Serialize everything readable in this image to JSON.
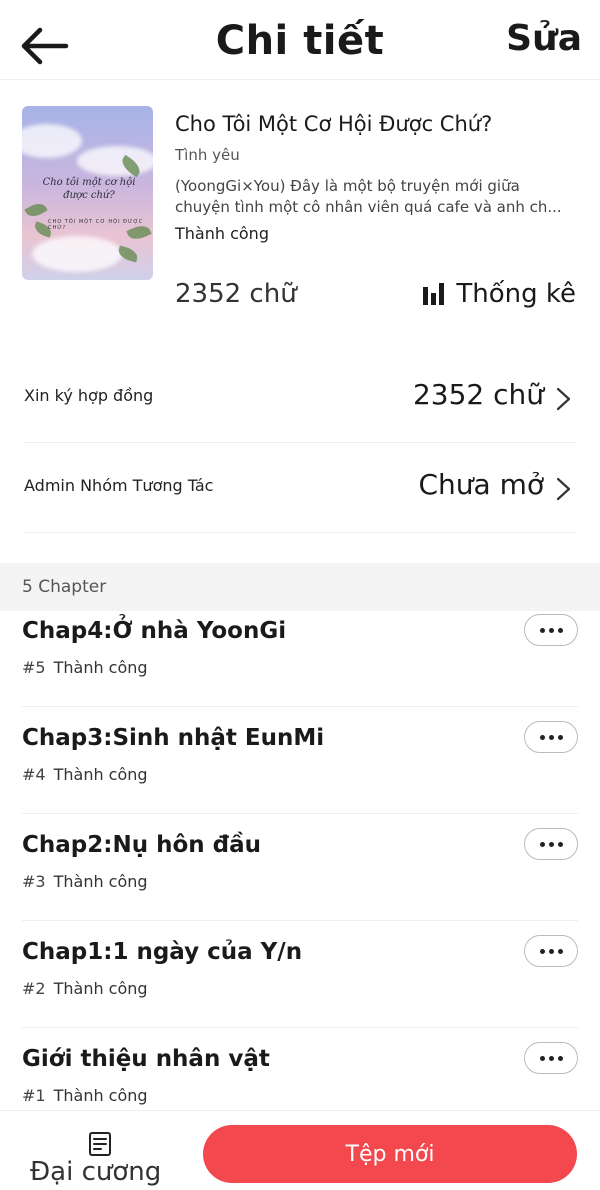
{
  "header": {
    "title": "Chi tiết",
    "edit_label": "Sửa"
  },
  "book": {
    "cover_title": "Cho tôi một cơ hội được chứ?",
    "cover_subtitle": "CHO TÔI MỘT CƠ HỘI ĐƯỢC CHỨ?",
    "title": "Cho Tôi Một Cơ Hội Được Chứ?",
    "genre": "Tình yêu",
    "description_line1": "(YoongGi×You) Đây là một bộ truyện mới giữa",
    "description_line2": "chuyện tình một cô nhân viên quá cafe và anh ch...",
    "status": "Thành công",
    "word_count": "2352 chữ",
    "stats_label": "Thống kê"
  },
  "rows": [
    {
      "label": "Xin ký hợp đồng",
      "value": "2352 chữ"
    },
    {
      "label": "Admin Nhóm Tương Tác",
      "value": "Chưa mở"
    }
  ],
  "chapters_header": "5 Chapter",
  "chapters": [
    {
      "title": "Chap4:Ở nhà YoonGi",
      "number": "#5",
      "status": "Thành công"
    },
    {
      "title": "Chap3:Sinh nhật EunMi",
      "number": "#4",
      "status": "Thành công"
    },
    {
      "title": "Chap2:Nụ hôn đầu",
      "number": "#3",
      "status": "Thành công"
    },
    {
      "title": "Chap1:1 ngày của Y/n",
      "number": "#2",
      "status": "Thành công"
    },
    {
      "title": "Giới thiệu nhân vật",
      "number": "#1",
      "status": "Thành công"
    }
  ],
  "bottom": {
    "outline_label": "Đại cương",
    "new_file_label": "Tệp mới"
  },
  "colors": {
    "accent": "#f2484e",
    "section_bg": "#f4f4f4"
  }
}
